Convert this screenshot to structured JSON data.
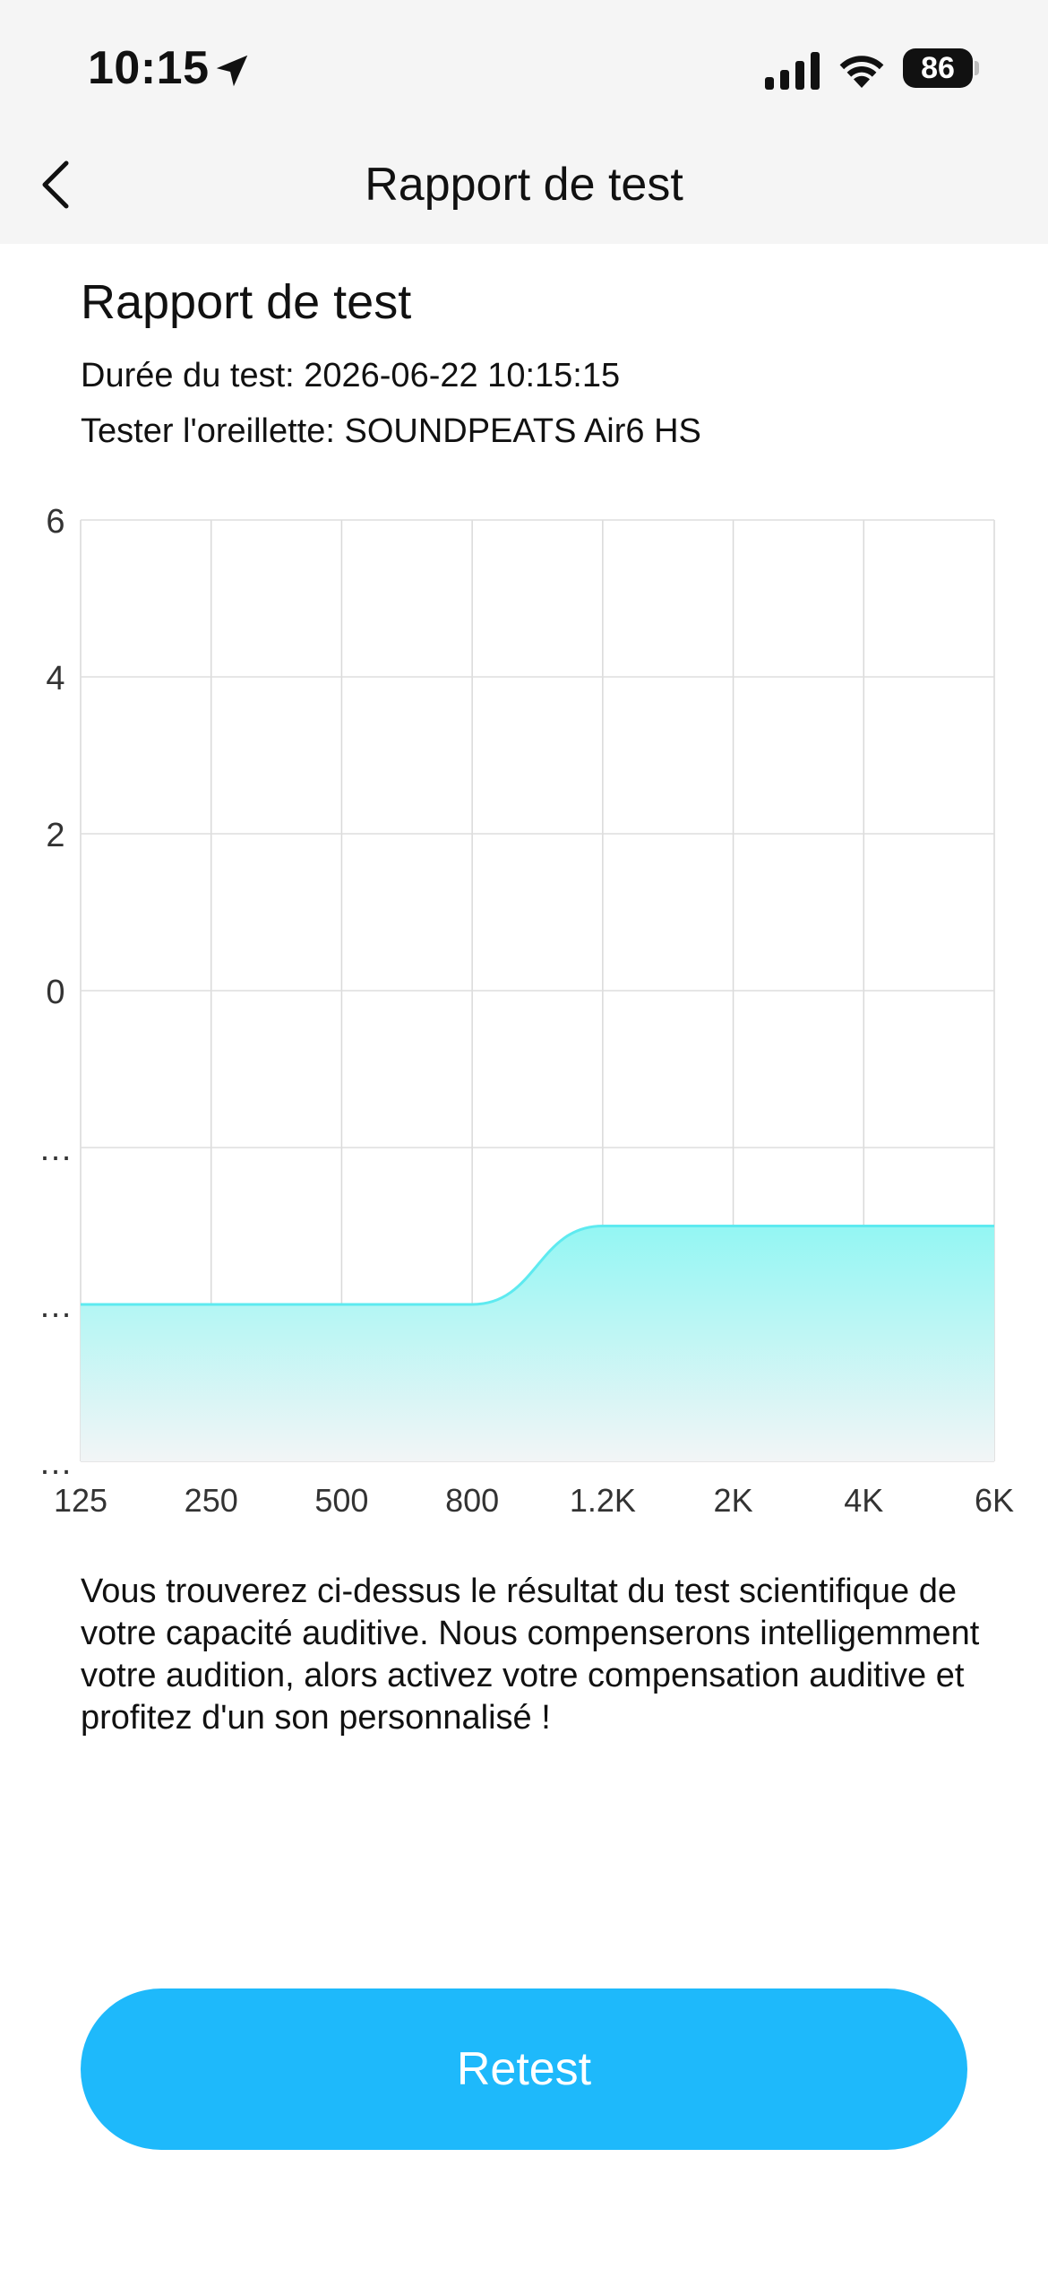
{
  "status_bar": {
    "time": "10:15",
    "battery": "86"
  },
  "nav": {
    "title": "Rapport de test"
  },
  "report": {
    "title": "Rapport de test",
    "duration_line": "Durée du test: 2026-06-22 10:15:15",
    "earbud_line": "Tester l'oreillette: SOUNDPEATS Air6 HS"
  },
  "chart_data": {
    "type": "area",
    "categories": [
      "125",
      "250",
      "500",
      "800",
      "1.2K",
      "2K",
      "4K",
      "6K"
    ],
    "y_tick_labels": [
      "6",
      "4",
      "2",
      "0",
      "…",
      "…",
      "…"
    ],
    "y_ticks": [
      6,
      4,
      2,
      0,
      -2,
      -4,
      -6
    ],
    "ylim": [
      -6,
      6
    ],
    "series": [
      {
        "values": [
          -4,
          -4,
          -4,
          -4,
          -3,
          -3,
          -3,
          -3
        ]
      }
    ],
    "grid": true,
    "fill_color_top": "#93f6f3",
    "fill_color_bottom": "#f2f5f6",
    "line_color": "#5eeaf0"
  },
  "description": "Vous trouverez ci-dessus le résultat du test scientifique de votre capacité auditive. Nous compenserons intelligemment votre audition, alors activez votre compensation auditive et profitez d'un son personnalisé !",
  "actions": {
    "retest_label": "Retest"
  },
  "colors": {
    "accent": "#1eb9fb",
    "header_background": "#f5f5f5"
  }
}
